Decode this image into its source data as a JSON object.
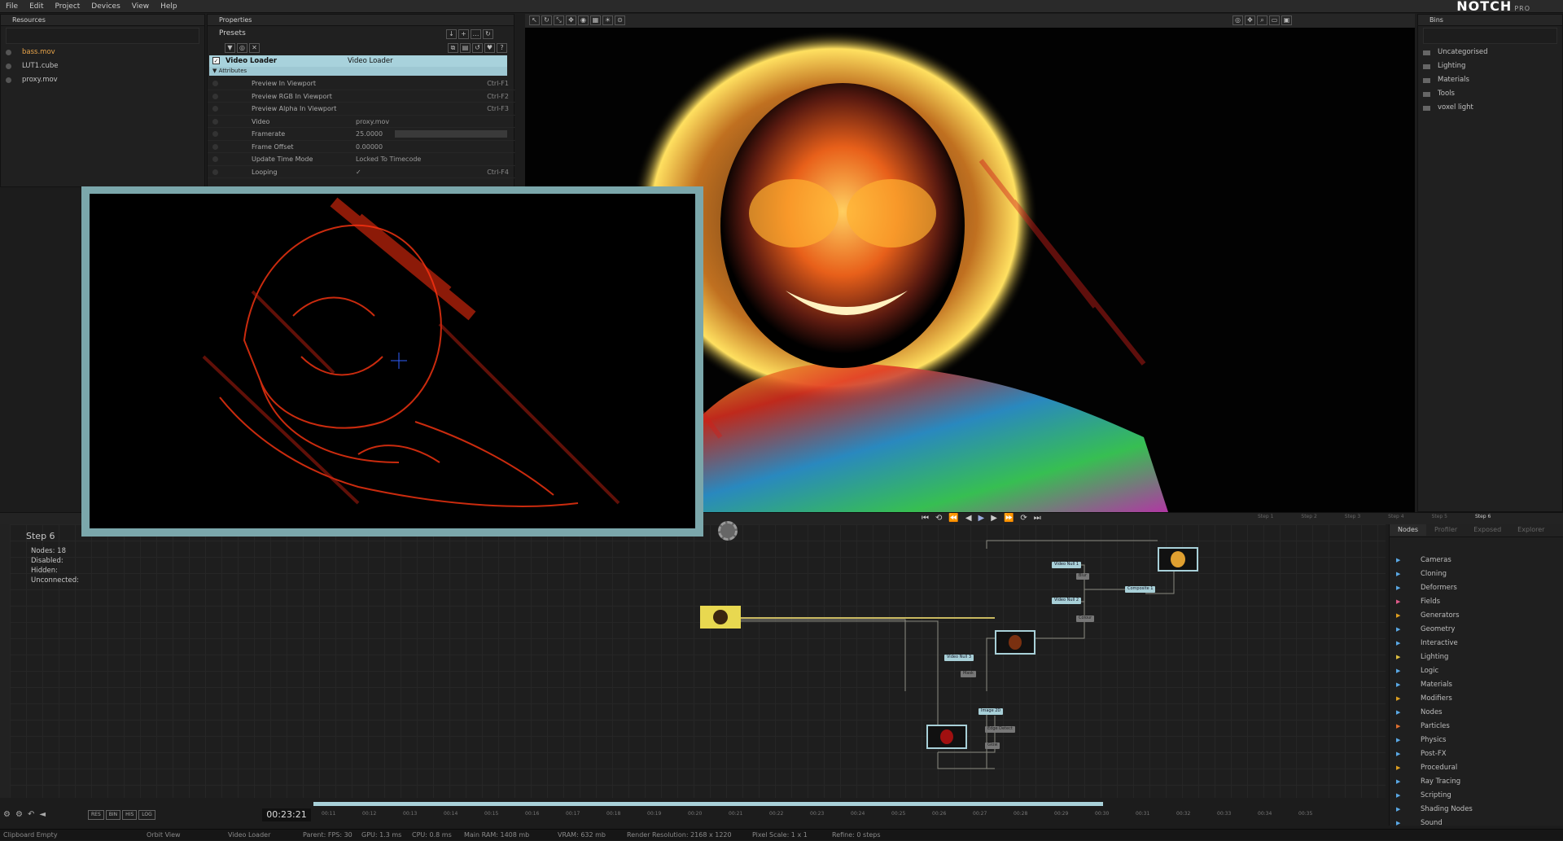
{
  "menu": [
    "File",
    "Edit",
    "Project",
    "Devices",
    "View",
    "Help"
  ],
  "logo": {
    "text": "NOTCH",
    "edition": "PRO"
  },
  "resources": {
    "title": "Resources",
    "items": [
      {
        "label": "bass.mov",
        "color": "#e8a44a"
      },
      {
        "label": "LUT1.cube",
        "color": "#c0c0c0"
      },
      {
        "label": "proxy.mov",
        "color": "#c0c0c0"
      }
    ]
  },
  "properties": {
    "title": "Properties",
    "presets": "Presets",
    "node_name": "Video Loader",
    "node_type": "Video Loader",
    "section": "Attributes",
    "rows": [
      {
        "label": "Preview In Viewport",
        "value": "",
        "shortcut": "Ctrl-F1"
      },
      {
        "label": "Preview RGB In Viewport",
        "value": "",
        "shortcut": "Ctrl-F2"
      },
      {
        "label": "Preview Alpha In Viewport",
        "value": "",
        "shortcut": "Ctrl-F3"
      },
      {
        "label": "Video",
        "value": "proxy.mov",
        "shortcut": ""
      },
      {
        "label": "Framerate",
        "value": "25.0000",
        "shortcut": ""
      },
      {
        "label": "Frame Offset",
        "value": "0.00000",
        "shortcut": ""
      },
      {
        "label": "Update Time Mode",
        "value": "Locked To Timecode",
        "shortcut": ""
      },
      {
        "label": "Looping",
        "value": "✓",
        "shortcut": "Ctrl-F4"
      }
    ]
  },
  "bins": {
    "title": "Bins",
    "items": [
      "Uncategorised",
      "Lighting",
      "Materials",
      "Tools",
      "voxel light"
    ]
  },
  "nodegraph": {
    "step": "Step  6",
    "stats": [
      "Nodes:  18",
      "Disabled:",
      "Hidden:",
      "Unconnected:"
    ],
    "nodes": [
      "Video Null 1",
      "Video Null 2",
      "Video Null 3",
      "Composite 1",
      "Edge Detect",
      "Image 2D",
      "Blur",
      "Colour",
      "Glow",
      "Mask"
    ]
  },
  "nodes_panel": {
    "tabs": [
      "Nodes",
      "Profiler",
      "Exposed",
      "Explorer"
    ],
    "categories": [
      {
        "label": "Cameras",
        "color": "#5aa9e6"
      },
      {
        "label": "Cloning",
        "color": "#5aa9e6"
      },
      {
        "label": "Deformers",
        "color": "#5aa9e6"
      },
      {
        "label": "Fields",
        "color": "#e05a8a"
      },
      {
        "label": "Generators",
        "color": "#e0a020"
      },
      {
        "label": "Geometry",
        "color": "#5aa9e6"
      },
      {
        "label": "Interactive",
        "color": "#5aa9e6"
      },
      {
        "label": "Lighting",
        "color": "#e0c040"
      },
      {
        "label": "Logic",
        "color": "#5aa9e6"
      },
      {
        "label": "Materials",
        "color": "#5aa9e6"
      },
      {
        "label": "Modifiers",
        "color": "#e0a020"
      },
      {
        "label": "Nodes",
        "color": "#5aa9e6"
      },
      {
        "label": "Particles",
        "color": "#e07030"
      },
      {
        "label": "Physics",
        "color": "#5aa9e6"
      },
      {
        "label": "Post-FX",
        "color": "#5aa9e6"
      },
      {
        "label": "Procedural",
        "color": "#e0a020"
      },
      {
        "label": "Ray Tracing",
        "color": "#5aa9e6"
      },
      {
        "label": "Scripting",
        "color": "#5aa9e6"
      },
      {
        "label": "Shading Nodes",
        "color": "#5aa9e6"
      },
      {
        "label": "Sound",
        "color": "#5aa9e6"
      }
    ]
  },
  "timeline": {
    "timecode": "00:23:21",
    "ticks": [
      "00:11",
      "00:12",
      "00:13",
      "00:14",
      "00:15",
      "00:16",
      "00:17",
      "00:18",
      "00:19",
      "00:20",
      "00:21",
      "00:22",
      "00:23",
      "00:24",
      "00:25",
      "00:26",
      "00:27",
      "00:28",
      "00:29",
      "00:30",
      "00:31",
      "00:32",
      "00:33",
      "00:34",
      "00:35"
    ],
    "buttons": [
      "RES",
      "BIN",
      "HIS",
      "LOG"
    ]
  },
  "steps": [
    "Step 1",
    "Step 2",
    "Step 3",
    "Step 4",
    "Step 5",
    "Step 6"
  ],
  "status": {
    "clipboard": "Clipboard Empty",
    "view": "Orbit View",
    "selected": "Video Loader",
    "fps": "Parent: FPS: 30",
    "gpu": "GPU: 1.3 ms",
    "cpu": "CPU: 0.8 ms",
    "ram": "Main RAM: 1408 mb",
    "vram": "VRAM: 632 mb",
    "res": "Render Resolution: 2168 x 1220",
    "pixel": "Pixel Scale: 1 x 1",
    "refine": "Refine: 0 steps"
  },
  "colors": {
    "accent": "#a8d0d8",
    "inset_border": "#7ba7ab"
  }
}
